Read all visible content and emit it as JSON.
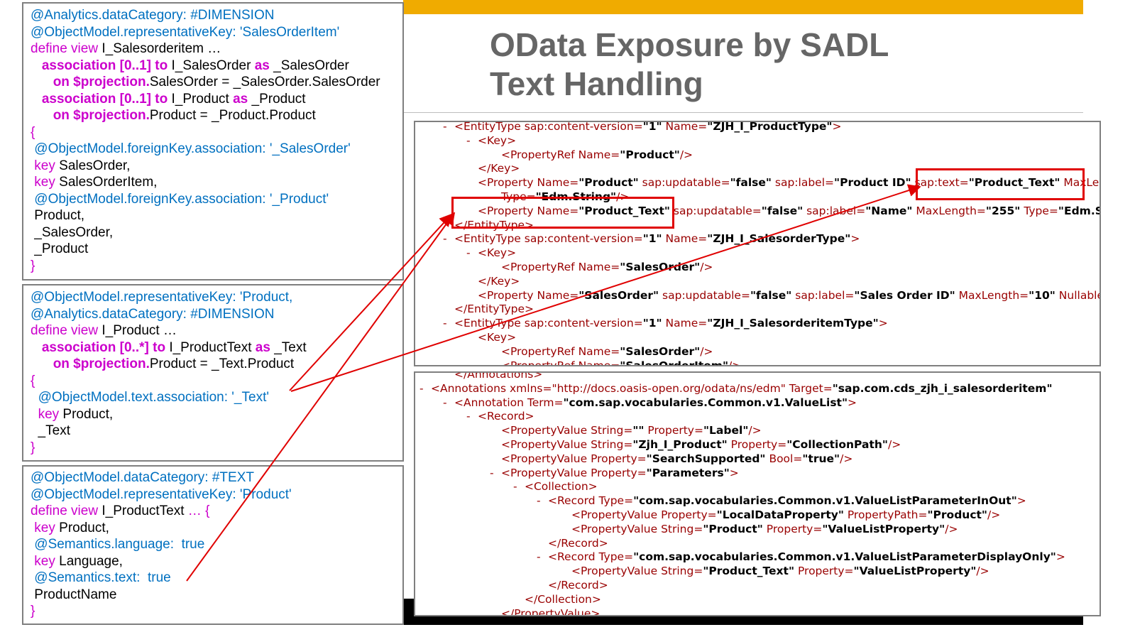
{
  "slide": {
    "title_line1": "OData Exposure by SADL",
    "title_line2": "Text Handling",
    "accent_color": "#f0ab00",
    "highlight_color": "#e00000"
  },
  "cds": {
    "box1": [
      [
        [
          "an",
          "@Analytics.dataCategory: #DIMENSION"
        ]
      ],
      [
        [
          "an",
          "@ObjectModel.representativeKey: 'SalesOrderItem'"
        ]
      ],
      [
        [
          "kw",
          "define view "
        ],
        [
          "tx",
          "I_Salesorderitem …"
        ]
      ],
      [
        [
          "tx",
          "   "
        ],
        [
          "kwb",
          "association [0..1] to "
        ],
        [
          "tx",
          "I_SalesOrder "
        ],
        [
          "kwb",
          "as "
        ],
        [
          "tx",
          "_SalesOrder"
        ]
      ],
      [
        [
          "tx",
          "      "
        ],
        [
          "kwb",
          "on $projection."
        ],
        [
          "tx",
          "SalesOrder = _SalesOrder.SalesOrder"
        ]
      ],
      [
        [
          "tx",
          "   "
        ],
        [
          "kwb",
          "association [0..1] to "
        ],
        [
          "tx",
          "I_Product "
        ],
        [
          "kwb",
          "as "
        ],
        [
          "tx",
          "_Product"
        ]
      ],
      [
        [
          "tx",
          "      "
        ],
        [
          "kwb",
          "on $projection."
        ],
        [
          "tx",
          "Product = _Product.Product"
        ]
      ],
      [
        [
          "brc",
          "{"
        ]
      ],
      [
        [
          "tx",
          " "
        ],
        [
          "an",
          "@ObjectModel.foreignKey.association: '_SalesOrder'"
        ]
      ],
      [
        [
          "tx",
          " "
        ],
        [
          "kw",
          "key "
        ],
        [
          "tx",
          "SalesOrder,"
        ]
      ],
      [
        [
          "tx",
          " "
        ],
        [
          "kw",
          "key "
        ],
        [
          "tx",
          "SalesOrderItem,"
        ]
      ],
      [
        [
          "tx",
          " "
        ],
        [
          "an",
          "@ObjectModel.foreignKey.association: '_Product'"
        ]
      ],
      [
        [
          "tx",
          " Product,"
        ]
      ],
      [
        [
          "tx",
          " _SalesOrder,"
        ]
      ],
      [
        [
          "tx",
          " _Product"
        ]
      ],
      [
        [
          "brc",
          "}"
        ]
      ]
    ],
    "box2": [
      [
        [
          "an",
          "@ObjectModel.representativeKey: 'Product,"
        ]
      ],
      [
        [
          "an",
          "@Analytics.dataCategory: #DIMENSION"
        ]
      ],
      [
        [
          "kw",
          "define view "
        ],
        [
          "tx",
          "I_Product …"
        ]
      ],
      [
        [
          "tx",
          "   "
        ],
        [
          "kwb",
          "association [0..*] to "
        ],
        [
          "tx",
          "I_ProductText "
        ],
        [
          "kwb",
          "as "
        ],
        [
          "tx",
          "_Text"
        ]
      ],
      [
        [
          "tx",
          "      "
        ],
        [
          "kwb",
          "on $projection."
        ],
        [
          "tx",
          "Product = _Text.Product"
        ]
      ],
      [
        [
          "brc",
          "{"
        ]
      ],
      [
        [
          "tx",
          "  "
        ],
        [
          "an",
          "@ObjectModel.text.association: '_Text'"
        ]
      ],
      [
        [
          "tx",
          "  "
        ],
        [
          "kw",
          "key "
        ],
        [
          "tx",
          "Product,"
        ]
      ],
      [
        [
          "tx",
          "  _Text"
        ]
      ],
      [
        [
          "brc",
          "}"
        ]
      ]
    ],
    "box3": [
      [
        [
          "an",
          "@ObjectModel.dataCategory: #TEXT"
        ]
      ],
      [
        [
          "an",
          "@ObjectModel.representativeKey: 'Product'"
        ]
      ],
      [
        [
          "kw",
          "define view "
        ],
        [
          "tx",
          "I_ProductText "
        ],
        [
          "kw",
          "… {"
        ]
      ],
      [
        [
          "tx",
          " "
        ],
        [
          "kw",
          "key "
        ],
        [
          "tx",
          "Product,"
        ]
      ],
      [
        [
          "tx",
          " "
        ],
        [
          "an",
          "@Semantics.language:  true"
        ]
      ],
      [
        [
          "tx",
          " "
        ],
        [
          "kw",
          "key "
        ],
        [
          "tx",
          "Language,"
        ]
      ],
      [
        [
          "tx",
          " "
        ],
        [
          "an",
          "@Semantics.text:  true"
        ]
      ],
      [
        [
          "tx",
          " ProductName"
        ]
      ],
      [
        [
          "brc",
          "}"
        ]
      ]
    ]
  },
  "xml": {
    "panel1": [
      {
        "i": 1,
        "m": "-",
        "s": [
          [
            "tg",
            "<EntityType sap:content-version="
          ],
          [
            "vl",
            "\"1\""
          ],
          [
            "tg",
            " Name="
          ],
          [
            "vl",
            "\"ZJH_I_ProductType\""
          ],
          [
            "tg",
            ">"
          ]
        ]
      },
      {
        "i": 2,
        "m": "-",
        "s": [
          [
            "tg",
            "<Key>"
          ]
        ]
      },
      {
        "i": 3,
        "m": "",
        "s": [
          [
            "tg",
            "<PropertyRef Name="
          ],
          [
            "vl",
            "\"Product\""
          ],
          [
            "tg",
            "/>"
          ]
        ]
      },
      {
        "i": 2,
        "m": "",
        "s": [
          [
            "tg",
            "</Key>"
          ]
        ]
      },
      {
        "i": 2,
        "m": "",
        "s": [
          [
            "tg",
            "<Property Name="
          ],
          [
            "vl",
            "\"Product\""
          ],
          [
            "tg",
            " sap:updatable="
          ],
          [
            "vl",
            "\"false\""
          ],
          [
            "tg",
            " sap:label="
          ],
          [
            "vl",
            "\"Product ID\""
          ],
          [
            "tg",
            " sap:text="
          ],
          [
            "vl",
            "\"Product_Text\""
          ],
          [
            "tg",
            " MaxLength="
          ]
        ]
      },
      {
        "i": 3,
        "m": "",
        "s": [
          [
            "tg",
            "Type="
          ],
          [
            "vl",
            "\"Edm.String\""
          ],
          [
            "tg",
            "/>"
          ]
        ]
      },
      {
        "i": 2,
        "m": "",
        "s": [
          [
            "tg",
            "<Property Name="
          ],
          [
            "vl",
            "\"Product_Text\""
          ],
          [
            "tg",
            " sap:updatable="
          ],
          [
            "vl",
            "\"false\""
          ],
          [
            "tg",
            " sap:label="
          ],
          [
            "vl",
            "\"Name\""
          ],
          [
            "tg",
            " MaxLength="
          ],
          [
            "vl",
            "\"255\""
          ],
          [
            "tg",
            " Type="
          ],
          [
            "vl",
            "\"Edm.String\""
          ]
        ]
      },
      {
        "i": 1,
        "m": "",
        "s": [
          [
            "tg",
            "</EntityType>"
          ]
        ]
      },
      {
        "i": 1,
        "m": "-",
        "s": [
          [
            "tg",
            "<EntityType sap:content-version="
          ],
          [
            "vl",
            "\"1\""
          ],
          [
            "tg",
            " Name="
          ],
          [
            "vl",
            "\"ZJH_I_SalesorderType\""
          ],
          [
            "tg",
            ">"
          ]
        ]
      },
      {
        "i": 2,
        "m": "-",
        "s": [
          [
            "tg",
            "<Key>"
          ]
        ]
      },
      {
        "i": 3,
        "m": "",
        "s": [
          [
            "tg",
            "<PropertyRef Name="
          ],
          [
            "vl",
            "\"SalesOrder\""
          ],
          [
            "tg",
            "/>"
          ]
        ]
      },
      {
        "i": 2,
        "m": "",
        "s": [
          [
            "tg",
            "</Key>"
          ]
        ]
      },
      {
        "i": 2,
        "m": "",
        "s": [
          [
            "tg",
            "<Property Name="
          ],
          [
            "vl",
            "\"SalesOrder\""
          ],
          [
            "tg",
            " sap:updatable="
          ],
          [
            "vl",
            "\"false\""
          ],
          [
            "tg",
            " sap:label="
          ],
          [
            "vl",
            "\"Sales Order ID\""
          ],
          [
            "tg",
            " MaxLength="
          ],
          [
            "vl",
            "\"10\""
          ],
          [
            "tg",
            " Nullable="
          ]
        ]
      },
      {
        "i": 1,
        "m": "",
        "s": [
          [
            "tg",
            "</EntityType>"
          ]
        ]
      },
      {
        "i": 1,
        "m": "-",
        "s": [
          [
            "tg",
            "<EntityType sap:content-version="
          ],
          [
            "vl",
            "\"1\""
          ],
          [
            "tg",
            " Name="
          ],
          [
            "vl",
            "\"ZJH_I_SalesorderitemType\""
          ],
          [
            "tg",
            ">"
          ]
        ]
      },
      {
        "i": 2,
        "m": "",
        "s": [
          [
            "tg",
            "<Key>"
          ]
        ]
      },
      {
        "i": 3,
        "m": "",
        "s": [
          [
            "tg",
            "<PropertyRef Name="
          ],
          [
            "vl",
            "\"SalesOrder\""
          ],
          [
            "tg",
            "/>"
          ]
        ]
      },
      {
        "i": 3,
        "m": "",
        "s": [
          [
            "tg",
            "<PropertyRef Name="
          ],
          [
            "vl",
            "\"SalesOrderItem\""
          ],
          [
            "tg",
            "/>"
          ]
        ]
      }
    ],
    "panel2": [
      {
        "i": 1,
        "m": "",
        "s": [
          [
            "tg",
            "</Annotations>"
          ]
        ]
      },
      {
        "i": 0,
        "m": "-",
        "s": [
          [
            "tg",
            "<Annotations xmlns="
          ],
          [
            "hl",
            "\"http://docs.oasis-open.org/odata/ns/edm\""
          ],
          [
            "tg",
            " Target="
          ],
          [
            "vl",
            "\"sap.com.cds_zjh_i_salesorderitem\""
          ]
        ]
      },
      {
        "i": 1,
        "m": "-",
        "s": [
          [
            "tg",
            "<Annotation Term="
          ],
          [
            "vl",
            "\"com.sap.vocabularies.Common.v1.ValueList\""
          ],
          [
            "tg",
            ">"
          ]
        ]
      },
      {
        "i": 2,
        "m": "-",
        "s": [
          [
            "tg",
            "<Record>"
          ]
        ]
      },
      {
        "i": 3,
        "m": "",
        "s": [
          [
            "tg",
            "<PropertyValue String="
          ],
          [
            "vl",
            "\"\""
          ],
          [
            "tg",
            " Property="
          ],
          [
            "vl",
            "\"Label\""
          ],
          [
            "tg",
            "/>"
          ]
        ]
      },
      {
        "i": 3,
        "m": "",
        "s": [
          [
            "tg",
            "<PropertyValue String="
          ],
          [
            "vl",
            "\"Zjh_I_Product\""
          ],
          [
            "tg",
            " Property="
          ],
          [
            "vl",
            "\"CollectionPath\""
          ],
          [
            "tg",
            "/>"
          ]
        ]
      },
      {
        "i": 3,
        "m": "",
        "s": [
          [
            "tg",
            "<PropertyValue Property="
          ],
          [
            "vl",
            "\"SearchSupported\""
          ],
          [
            "tg",
            " Bool="
          ],
          [
            "vl",
            "\"true\""
          ],
          [
            "tg",
            "/>"
          ]
        ]
      },
      {
        "i": 3,
        "m": "-",
        "s": [
          [
            "tg",
            "<PropertyValue Property="
          ],
          [
            "vl",
            "\"Parameters\""
          ],
          [
            "tg",
            ">"
          ]
        ]
      },
      {
        "i": 4,
        "m": "-",
        "s": [
          [
            "tg",
            "<Collection>"
          ]
        ]
      },
      {
        "i": 5,
        "m": "-",
        "s": [
          [
            "tg",
            "<Record Type="
          ],
          [
            "vl",
            "\"com.sap.vocabularies.Common.v1.ValueListParameterInOut\""
          ],
          [
            "tg",
            ">"
          ]
        ]
      },
      {
        "i": 6,
        "m": "",
        "s": [
          [
            "tg",
            "<PropertyValue Property="
          ],
          [
            "vl",
            "\"LocalDataProperty\""
          ],
          [
            "tg",
            " PropertyPath="
          ],
          [
            "vl",
            "\"Product\""
          ],
          [
            "tg",
            "/>"
          ]
        ]
      },
      {
        "i": 6,
        "m": "",
        "s": [
          [
            "tg",
            "<PropertyValue String="
          ],
          [
            "vl",
            "\"Product\""
          ],
          [
            "tg",
            " Property="
          ],
          [
            "vl",
            "\"ValueListProperty\""
          ],
          [
            "tg",
            "/>"
          ]
        ]
      },
      {
        "i": 5,
        "m": "",
        "s": [
          [
            "tg",
            "</Record>"
          ]
        ]
      },
      {
        "i": 5,
        "m": "-",
        "s": [
          [
            "tg",
            "<Record Type="
          ],
          [
            "vl",
            "\"com.sap.vocabularies.Common.v1.ValueListParameterDisplayOnly\""
          ],
          [
            "tg",
            ">"
          ]
        ]
      },
      {
        "i": 6,
        "m": "",
        "s": [
          [
            "tg",
            "<PropertyValue String="
          ],
          [
            "vl",
            "\"Product_Text\""
          ],
          [
            "tg",
            " Property="
          ],
          [
            "vl",
            "\"ValueListProperty\""
          ],
          [
            "tg",
            "/>"
          ]
        ]
      },
      {
        "i": 5,
        "m": "",
        "s": [
          [
            "tg",
            "</Record>"
          ]
        ]
      },
      {
        "i": 4,
        "m": "",
        "s": [
          [
            "tg",
            "</Collection>"
          ]
        ]
      },
      {
        "i": 3,
        "m": "",
        "s": [
          [
            "tg",
            "</PropertyValue>"
          ]
        ]
      }
    ]
  }
}
